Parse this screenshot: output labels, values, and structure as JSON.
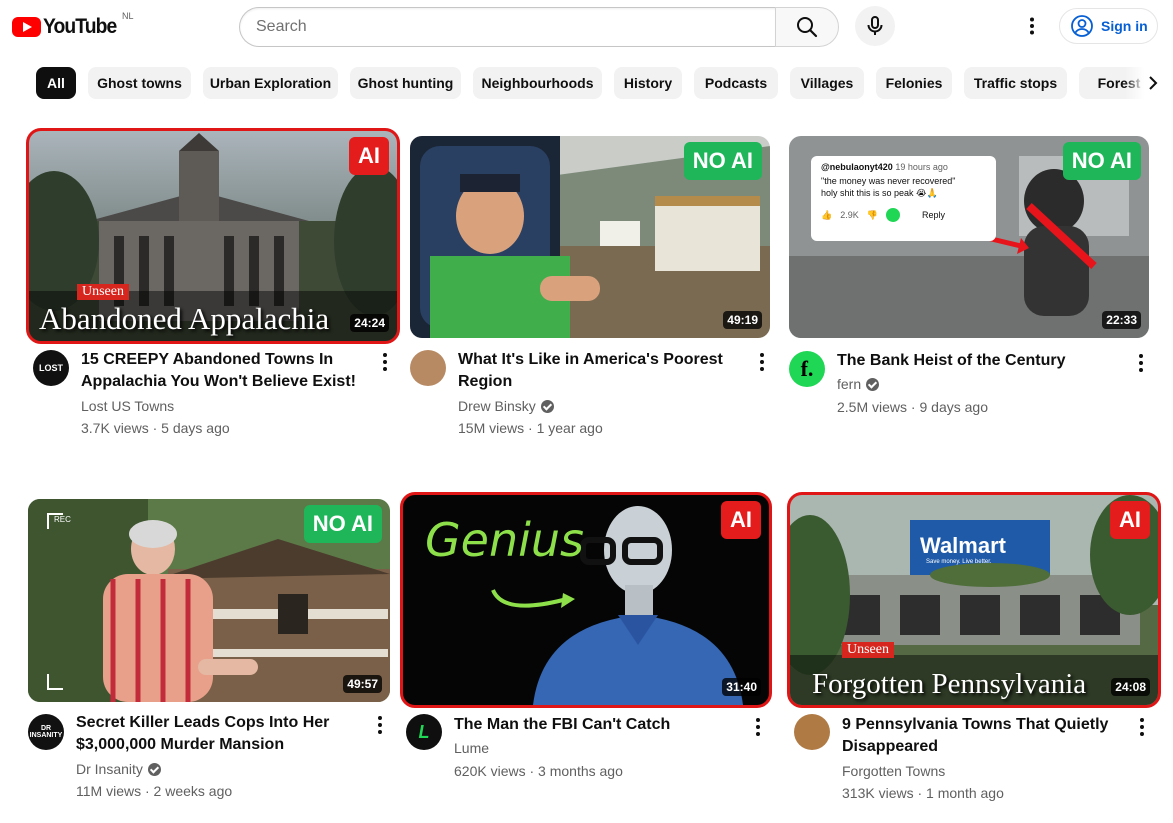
{
  "header": {
    "logo_text": "YouTube",
    "country_code": "NL",
    "search_placeholder": "Search",
    "signin_label": "Sign in"
  },
  "chips": [
    "All",
    "Ghost towns",
    "Urban Exploration",
    "Ghost hunting",
    "Neighbourhoods",
    "History",
    "Podcasts",
    "Villages",
    "Felonies",
    "Traffic stops",
    "Forest"
  ],
  "videos": [
    {
      "title_line1": "15 CREEPY Abandoned Towns In",
      "title_line2": "Appalachia You Won't Believe Exist!",
      "channel": "Lost US Towns",
      "verified": false,
      "views": "3.7K views",
      "age": "5 days ago",
      "duration": "24:24",
      "badge": "AI",
      "thumb_tag": "Unseen",
      "thumb_title": "Abandoned Appalachia",
      "avatar_text": "LOST"
    },
    {
      "title_line1": "What It's Like in America's Poorest",
      "title_line2": "Region",
      "channel": "Drew Binsky",
      "verified": true,
      "views": "15M views",
      "age": "1 year ago",
      "duration": "49:19",
      "badge": "NO AI"
    },
    {
      "title_line1": "The Bank Heist of the Century",
      "title_line2": "",
      "channel": "fern",
      "verified": true,
      "views": "2.5M views",
      "age": "9 days ago",
      "duration": "22:33",
      "badge": "NO AI",
      "avatar_text": "f.",
      "comment": {
        "user": "@nebulaonyt420",
        "time": "19 hours ago",
        "line1": "\"the money was never recovered\"",
        "line2": "holy shit this is so peak 😭🙏",
        "likes": "2.9K",
        "reply": "Reply"
      }
    },
    {
      "title_line1": "Secret Killer Leads Cops Into Her",
      "title_line2": "$3,000,000 Murder Mansion",
      "channel": "Dr Insanity",
      "verified": true,
      "views": "11M views",
      "age": "2 weeks ago",
      "duration": "49:57",
      "badge": "NO AI",
      "avatar_text": "DR INSANITY",
      "rec_label": "REC"
    },
    {
      "title_line1": "The Man the FBI Can't Catch",
      "title_line2": "",
      "channel": "Lume",
      "verified": false,
      "views": "620K views",
      "age": "3 months ago",
      "duration": "31:40",
      "badge": "AI",
      "thumb_title": "Genius",
      "avatar_text": "L"
    },
    {
      "title_line1": "9 Pennsylvania Towns That Quietly",
      "title_line2": "Disappeared",
      "channel": "Forgotten Towns",
      "verified": false,
      "views": "313K views",
      "age": "1 month ago",
      "duration": "24:08",
      "badge": "AI",
      "thumb_tag": "Unseen",
      "thumb_title": "Forgotten Pennsylvania",
      "store_sign": "Walmart",
      "store_tagline": "Save money. Live better."
    }
  ],
  "colors": {
    "ai_badge": "#e51c1c",
    "no_ai_badge": "#1fb65a",
    "flag_outline": "#e01515",
    "signin_blue": "#065fd4"
  }
}
